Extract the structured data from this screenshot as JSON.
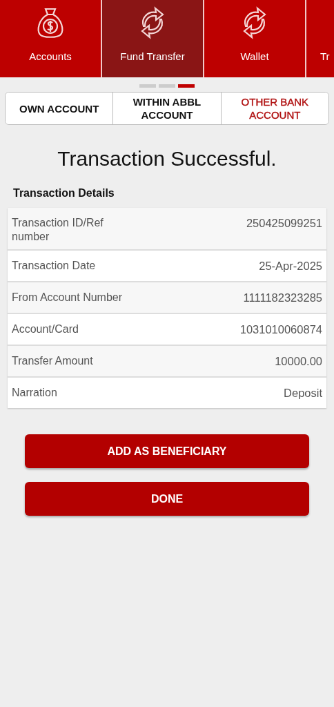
{
  "nav_tabs": [
    {
      "label": "Accounts",
      "kind": "bag",
      "selected": false
    },
    {
      "label": "Fund Transfer",
      "kind": "transfer",
      "selected": true
    },
    {
      "label": "Wallet",
      "kind": "transfer",
      "selected": false
    },
    {
      "label": "Tr",
      "kind": "cut",
      "selected": false
    }
  ],
  "page_dots": [
    {
      "selected": false
    },
    {
      "selected": false
    },
    {
      "selected": true
    }
  ],
  "segments": [
    {
      "label": "OWN ACCOUNT",
      "selected": false
    },
    {
      "label": "WITHIN ABBL ACCOUNT",
      "selected": false
    },
    {
      "label": "OTHER BANK ACCOUNT",
      "selected": true
    }
  ],
  "title": "Transaction Successful.",
  "details_heading": "Transaction Details",
  "details": [
    {
      "label": "Transaction ID/Ref number",
      "value": "250425099251"
    },
    {
      "label": "Transaction Date",
      "value": "25-Apr-2025"
    },
    {
      "label": "From Account Number",
      "value": "1111182323285"
    },
    {
      "label": "Account/Card",
      "value": "1031010060874"
    },
    {
      "label": "Transfer Amount",
      "value": "10000.00"
    },
    {
      "label": "Narration",
      "value": "Deposit"
    }
  ],
  "buttons": [
    "ADD AS BENEFICIARY",
    "DONE"
  ]
}
